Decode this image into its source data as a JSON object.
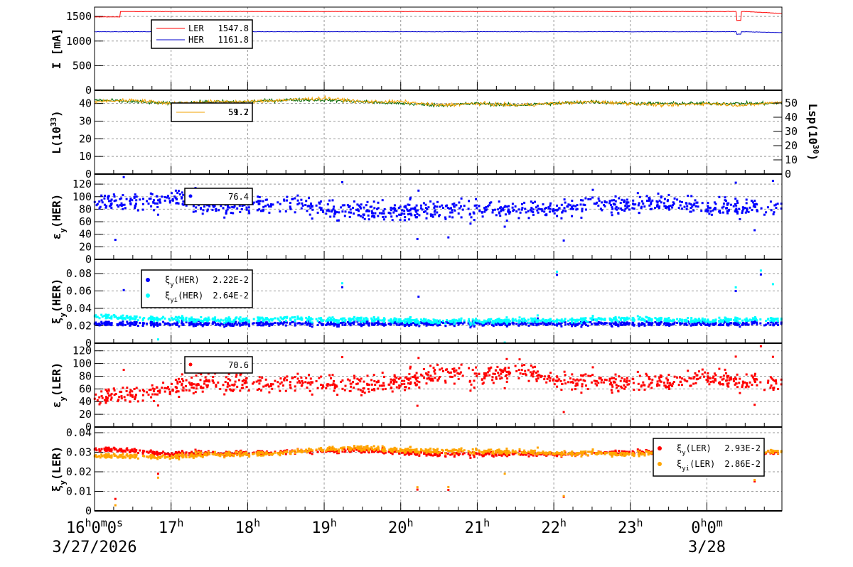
{
  "chart_data": {
    "type": "line",
    "x_unit": "hour",
    "x": [
      16,
      16.5,
      17,
      17.5,
      18,
      18.5,
      19,
      19.5,
      20,
      20.5,
      21,
      21.5,
      22,
      22.5,
      23,
      23.5,
      24,
      24.5,
      25
    ],
    "xlim": [
      16,
      24.98
    ],
    "x_ticks": [
      {
        "value": 16,
        "parts": [
          "16",
          "h",
          "0",
          "m",
          "0",
          "s"
        ]
      },
      {
        "value": 17,
        "parts": [
          "17",
          "h"
        ]
      },
      {
        "value": 18,
        "parts": [
          "18",
          "h"
        ]
      },
      {
        "value": 19,
        "parts": [
          "19",
          "h"
        ]
      },
      {
        "value": 20,
        "parts": [
          "20",
          "h"
        ]
      },
      {
        "value": 21,
        "parts": [
          "21",
          "h"
        ]
      },
      {
        "value": 22,
        "parts": [
          "22",
          "h"
        ]
      },
      {
        "value": 23,
        "parts": [
          "23",
          "h"
        ]
      },
      {
        "value": 24,
        "parts": [
          "0",
          "h",
          "0",
          "m"
        ]
      }
    ],
    "dates": [
      {
        "value": 16,
        "label": "3/27/2026"
      },
      {
        "value": 24,
        "label": "3/28"
      }
    ],
    "grid": true,
    "panels": [
      {
        "id": "current",
        "ylabel": {
          "main": "I [mA]",
          "sub": "",
          "rest": ""
        },
        "ylim": [
          0,
          1690
        ],
        "yticks": [
          "0",
          "500",
          "1000",
          "1500"
        ],
        "ytick_values": [
          0,
          500,
          1000,
          1500
        ],
        "style": "line",
        "series": [
          {
            "name": "LER",
            "value": "1547.8",
            "color": "#ff0000",
            "values": [
              1490,
              1600,
              1600,
              1600,
              1600,
              1600,
              1600,
              1600,
              1600,
              1600,
              1600,
              1600,
              1600,
              1600,
              1600,
              1600,
              1600,
              1600,
              1560
            ]
          },
          {
            "name": "HER",
            "value": "1161.8",
            "color": "#0000cc",
            "values": [
              1190,
              1190,
              1190,
              1190,
              1190,
              1190,
              1190,
              1190,
              1190,
              1190,
              1190,
              1190,
              1190,
              1190,
              1190,
              1190,
              1190,
              1190,
              1170
            ]
          }
        ]
      },
      {
        "id": "luminosity",
        "ylabel": {
          "main": "L(10",
          "sup": "33",
          "rest": ")"
        },
        "ylim": [
          0,
          47.5
        ],
        "yticks": [
          "0",
          "10",
          "20",
          "30",
          "40"
        ],
        "ytick_values": [
          0,
          10,
          20,
          30,
          40
        ],
        "style": "line",
        "right_axis": {
          "label": {
            "main": "Lsp(10",
            "sup": "30",
            "rest": ")"
          },
          "ylim": [
            0,
            59
          ],
          "yticks": [
            "0",
            "10",
            "20",
            "30",
            "40",
            "50"
          ],
          "ytick_values": [
            0,
            10,
            20,
            30,
            40,
            50
          ]
        },
        "series": [
          {
            "name": "",
            "value": "51.7",
            "color": "#006600",
            "values": [
              42,
              41,
              40,
              41,
              41,
              42,
              42,
              41,
              40,
              39,
              40,
              39,
              40,
              41,
              40,
              40,
              40,
              40,
              40
            ]
          },
          {
            "name": "",
            "value": "59.2",
            "color": "#f0a000",
            "values": [
              41,
              42,
              40,
              41,
              41,
              42,
              43,
              41,
              41,
              39,
              40,
              39,
              40,
              41,
              40,
              39,
              40,
              39,
              41
            ]
          }
        ]
      },
      {
        "id": "emit-her",
        "ylabel": {
          "main": "ε",
          "sub": "y",
          "rest": "(HER)"
        },
        "ylim": [
          0,
          136
        ],
        "yticks": [
          "0",
          "20",
          "40",
          "60",
          "80",
          "100",
          "120"
        ],
        "ytick_values": [
          0,
          20,
          40,
          60,
          80,
          100,
          120
        ],
        "style": "scatter",
        "series": [
          {
            "name": "",
            "value": "76.4",
            "color": "#0000ff",
            "values": [
              92,
              90,
              100,
              85,
              88,
              88,
              82,
              75,
              76,
              78,
              80,
              78,
              80,
              88,
              88,
              92,
              85,
              82,
              82
            ]
          }
        ]
      },
      {
        "id": "xi-her",
        "ylabel": {
          "main": "ξ",
          "sub": "y",
          "rest": "(HER)"
        },
        "ylim": [
          0,
          0.0963
        ],
        "yticks": [
          "0",
          "0.02",
          "0.04",
          "0.06",
          "0.08"
        ],
        "ytick_values": [
          0,
          0.02,
          0.04,
          0.06,
          0.08
        ],
        "style": "scatter",
        "series": [
          {
            "name": "ξy(HER)",
            "sym": {
              "main": "ξ",
              "sub": "y",
              "rest": "(HER)"
            },
            "value": "2.22E-2",
            "color": "#0000ff",
            "values": [
              0.0225,
              0.0225,
              0.0225,
              0.0225,
              0.0225,
              0.0225,
              0.0225,
              0.0225,
              0.0225,
              0.0225,
              0.0225,
              0.0225,
              0.0225,
              0.0225,
              0.0225,
              0.0225,
              0.0225,
              0.0225,
              0.0225
            ]
          },
          {
            "name": "ξyi(HER)",
            "sym": {
              "main": "ξ",
              "sub": "yi",
              "rest": "(HER)"
            },
            "value": "2.64E-2",
            "color": "#00ffff",
            "values": [
              0.031,
              0.029,
              0.028,
              0.027,
              0.027,
              0.028,
              0.027,
              0.027,
              0.026,
              0.025,
              0.025,
              0.026,
              0.026,
              0.027,
              0.028,
              0.027,
              0.026,
              0.027,
              0.027
            ]
          }
        ]
      },
      {
        "id": "emit-ler",
        "ylabel": {
          "main": "ε",
          "sub": "y",
          "rest": "(LER)"
        },
        "ylim": [
          0,
          132
        ],
        "yticks": [
          "0",
          "20",
          "40",
          "60",
          "80",
          "100",
          "120"
        ],
        "ytick_values": [
          0,
          20,
          40,
          60,
          80,
          100,
          120
        ],
        "style": "scatter",
        "series": [
          {
            "name": "",
            "value": "70.6",
            "color": "#ff0000",
            "values": [
              45,
              52,
              62,
              72,
              68,
              68,
              70,
              64,
              70,
              85,
              78,
              90,
              75,
              72,
              70,
              72,
              80,
              70,
              68
            ]
          }
        ]
      },
      {
        "id": "xi-ler",
        "ylabel": {
          "main": "ξ",
          "sub": "y",
          "rest": "(LER)"
        },
        "ylim": [
          0,
          0.0429
        ],
        "yticks": [
          "0",
          "0.01",
          "0.02",
          "0.03",
          "0.04"
        ],
        "ytick_values": [
          0,
          0.01,
          0.02,
          0.03,
          0.04
        ],
        "style": "scatter",
        "series": [
          {
            "name": "ξy(LER)",
            "sym": {
              "main": "ξ",
              "sub": "y",
              "rest": "(LER)"
            },
            "value": "2.93E-2",
            "color": "#ff0000",
            "values": [
              0.0315,
              0.031,
              0.029,
              0.0295,
              0.0295,
              0.03,
              0.031,
              0.031,
              0.03,
              0.029,
              0.029,
              0.029,
              0.029,
              0.0295,
              0.03,
              0.03,
              0.03,
              0.03,
              0.03
            ]
          },
          {
            "name": "ξyi(LER)",
            "sym": {
              "main": "ξ",
              "sub": "yi",
              "rest": "(LER)"
            },
            "value": "2.86E-2",
            "color": "#ffa500",
            "values": [
              0.028,
              0.028,
              0.0275,
              0.029,
              0.029,
              0.0295,
              0.0315,
              0.032,
              0.031,
              0.0305,
              0.0305,
              0.03,
              0.0295,
              0.0295,
              0.029,
              0.03,
              0.0305,
              0.031,
              0.03
            ]
          }
        ]
      }
    ]
  }
}
